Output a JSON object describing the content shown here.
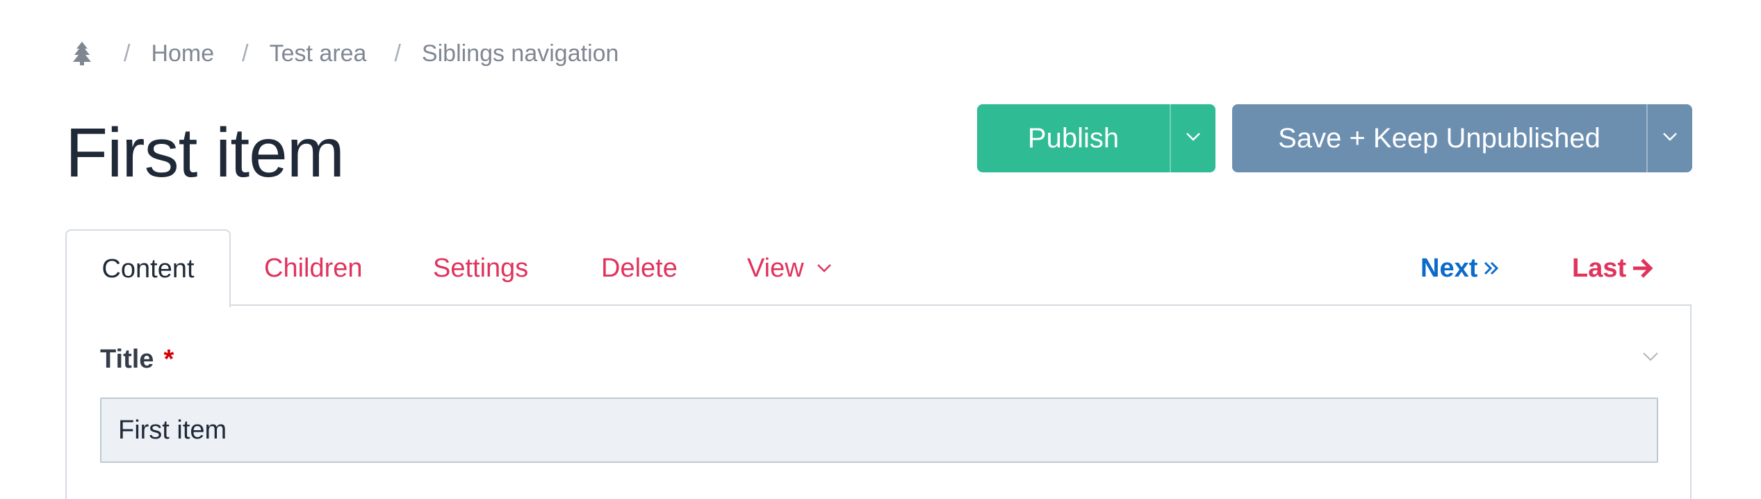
{
  "breadcrumb": {
    "home_icon": "tree-icon",
    "separator": "/",
    "items": [
      "Home",
      "Test area",
      "Siblings navigation"
    ]
  },
  "page": {
    "title": "First item"
  },
  "actions": {
    "publish_label": "Publish",
    "save_label": "Save + Keep Unpublished",
    "publish_color": "#2fbb93",
    "save_color": "#6c8fb0"
  },
  "tabs": [
    {
      "label": "Content",
      "active": true
    },
    {
      "label": "Children",
      "active": false
    },
    {
      "label": "Settings",
      "active": false
    },
    {
      "label": "Delete",
      "active": false
    },
    {
      "label": "View",
      "active": false
    }
  ],
  "sibling_nav": {
    "next_label": "Next",
    "last_label": "Last",
    "next_color": "#0b6bc9",
    "last_color": "#e0335d"
  },
  "fields": {
    "title": {
      "label": "Title",
      "required_mark": "*",
      "value": "First item"
    }
  }
}
